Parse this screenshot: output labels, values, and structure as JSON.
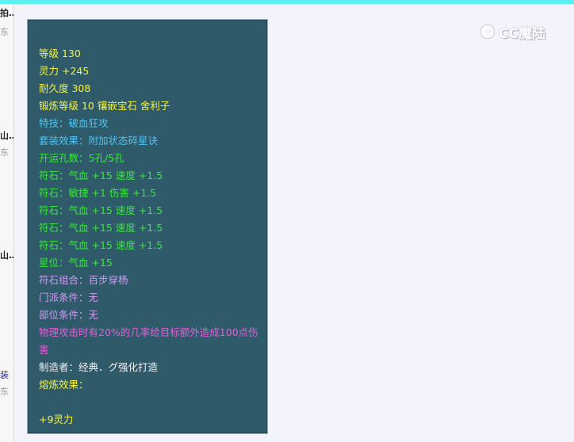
{
  "colors": {
    "yellow": "#f4f43c",
    "cyan": "#4fc3f0",
    "green": "#38e838",
    "lavender": "#c8a0f0",
    "magenta": "#e060d8",
    "white": "#f2f2f2",
    "panel_bg": "#2f5a6a"
  },
  "watermark": {
    "text": "CC魔陆",
    "icon": "cc-logo-icon"
  },
  "left_strip": {
    "frag1": "拍…",
    "frag2": "东",
    "frag3": "山…",
    "frag4": "东",
    "frag5": "山…",
    "frag6": "装",
    "frag7": "东"
  },
  "tooltip": {
    "level": "等级 130",
    "spirit": "灵力 +245",
    "durability": "耐久度 308",
    "forge": "锻炼等级 10 镶嵌宝石 舍利子",
    "skill": "特技：破血狂攻",
    "set_effect": "套装效果：附加状态碎星诀",
    "slots": "开运孔数：5孔/5孔",
    "rune1": "符石：气血 +15 速度 +1.5",
    "rune2": "符石：敏捷 +1 伤害 +1.5",
    "rune3": "符石：气血 +15 速度 +1.5",
    "rune4": "符石：气血 +15 速度 +1.5",
    "rune5": "符石：气血 +15 速度 +1.5",
    "star": "星位：气血 +15",
    "rune_combo": "符石组合：百步穿杨",
    "sect_req": "门派条件：无",
    "part_req": "部位条件：无",
    "effect_desc": "物理攻击时有20%的几率给目标额外造成100点伤害",
    "maker": "制造者：经典．グ强化打造",
    "melt_label": "熔炼效果：",
    "melt_value": "+9灵力"
  }
}
